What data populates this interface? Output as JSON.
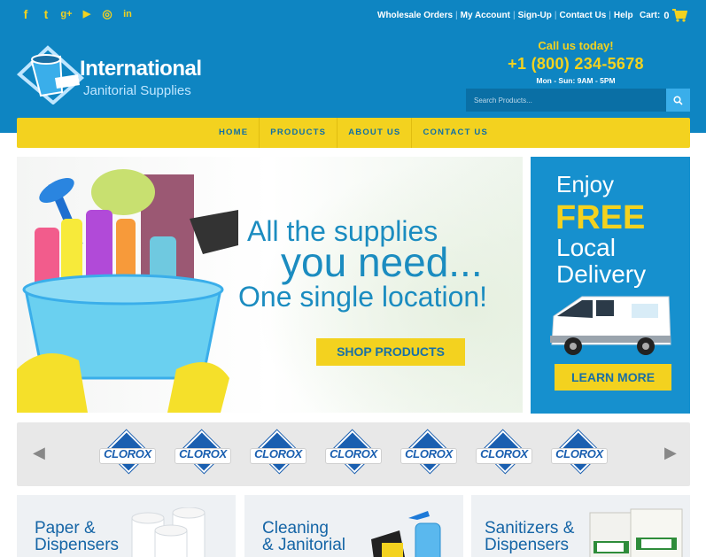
{
  "social": {
    "icons": [
      "facebook-icon",
      "twitter-icon",
      "google-plus-icon",
      "youtube-icon",
      "instagram-icon",
      "linkedin-icon"
    ],
    "glyphs": [
      "f",
      "t",
      "g+",
      "▶",
      "◎",
      "in"
    ]
  },
  "toplinks": {
    "wholesale": "Wholesale Orders",
    "account": "My Account",
    "signup": "Sign-Up",
    "contact": "Contact Us",
    "help": "Help",
    "sep": "|"
  },
  "cart": {
    "label": "Cart:",
    "count": "0"
  },
  "logo": {
    "line1": "International",
    "line2": "Janitorial Supplies"
  },
  "callus": {
    "title": "Call us today!",
    "phone": "+1 (800) 234-5678",
    "hours": "Mon - Sun: 9AM - 5PM"
  },
  "search": {
    "placeholder": "Search Products..."
  },
  "nav": {
    "home": "HOME",
    "products": "PRODUCTS",
    "about": "ABOUT US",
    "contact": "CONTACT US"
  },
  "hero": {
    "line1": "All the supplies",
    "line2": "you need...",
    "line3": "One single location!",
    "button": "SHOP PRODUCTS"
  },
  "promo": {
    "line1": "Enjoy",
    "line2": "FREE",
    "line3a": "Local",
    "line3b": "Delivery",
    "button": "LEARN MORE"
  },
  "brands": [
    "CLOROX",
    "CLOROX",
    "CLOROX",
    "CLOROX",
    "CLOROX",
    "CLOROX",
    "CLOROX"
  ],
  "categories": [
    {
      "line1": "Paper &",
      "line2": "Dispensers"
    },
    {
      "line1": "Cleaning",
      "line2": "& Janitorial"
    },
    {
      "line1": "Sanitizers &",
      "line2": "Dispensers"
    }
  ],
  "colors": {
    "brand_blue": "#0e85c2",
    "accent_yellow": "#f3d21f",
    "text_blue": "#1b8cc0"
  }
}
